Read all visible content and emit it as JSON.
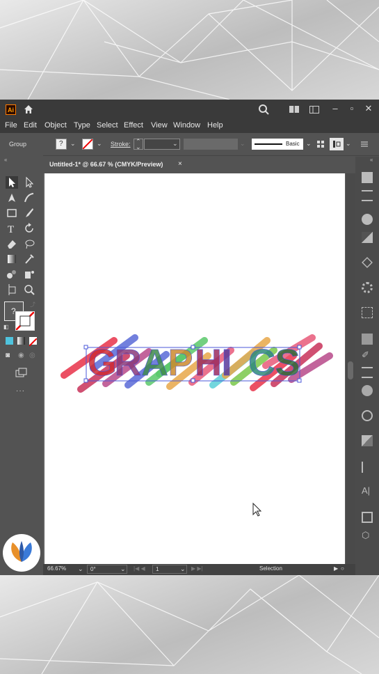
{
  "app": {
    "logo_text": "Ai",
    "menu": [
      "File",
      "Edit",
      "Object",
      "Type",
      "Select",
      "Effect",
      "View",
      "Window",
      "Help"
    ]
  },
  "control_bar": {
    "selection_type": "Group",
    "fill_value": "?",
    "stroke_label": "Stroke:",
    "brush_label": "Basic"
  },
  "document": {
    "tab_title": "Untitled-1* @ 66.67 % (CMYK/Preview)",
    "tab_close": "×",
    "artwork_text": "GRAPHICS"
  },
  "tools": {
    "fill_unknown": "?",
    "more": "···"
  },
  "status_bar": {
    "zoom": "66.67%",
    "rotation": "0°",
    "artboard_number": "1",
    "tool_name": "Selection"
  },
  "colors": {
    "ui_dark": "#3a3a3a",
    "ui_panel": "#535353",
    "artboard": "#ffffff",
    "logo_border": "#ff7c00",
    "selection": "#4a57d8",
    "letter_colors": [
      "#cc2a34",
      "#8a3a7a",
      "#3e8a4c",
      "#cc8a2e",
      "#9a2a5e",
      "#5a3a9a",
      "#2e8a7a",
      "#2e6a3a"
    ],
    "stroke_colors": [
      "#e8324a",
      "#c8325a",
      "#b84a8a",
      "#5a6ad8",
      "#5ac86a",
      "#e8a84a",
      "#e85a7a",
      "#5ad0d8",
      "#7ac84a"
    ]
  }
}
